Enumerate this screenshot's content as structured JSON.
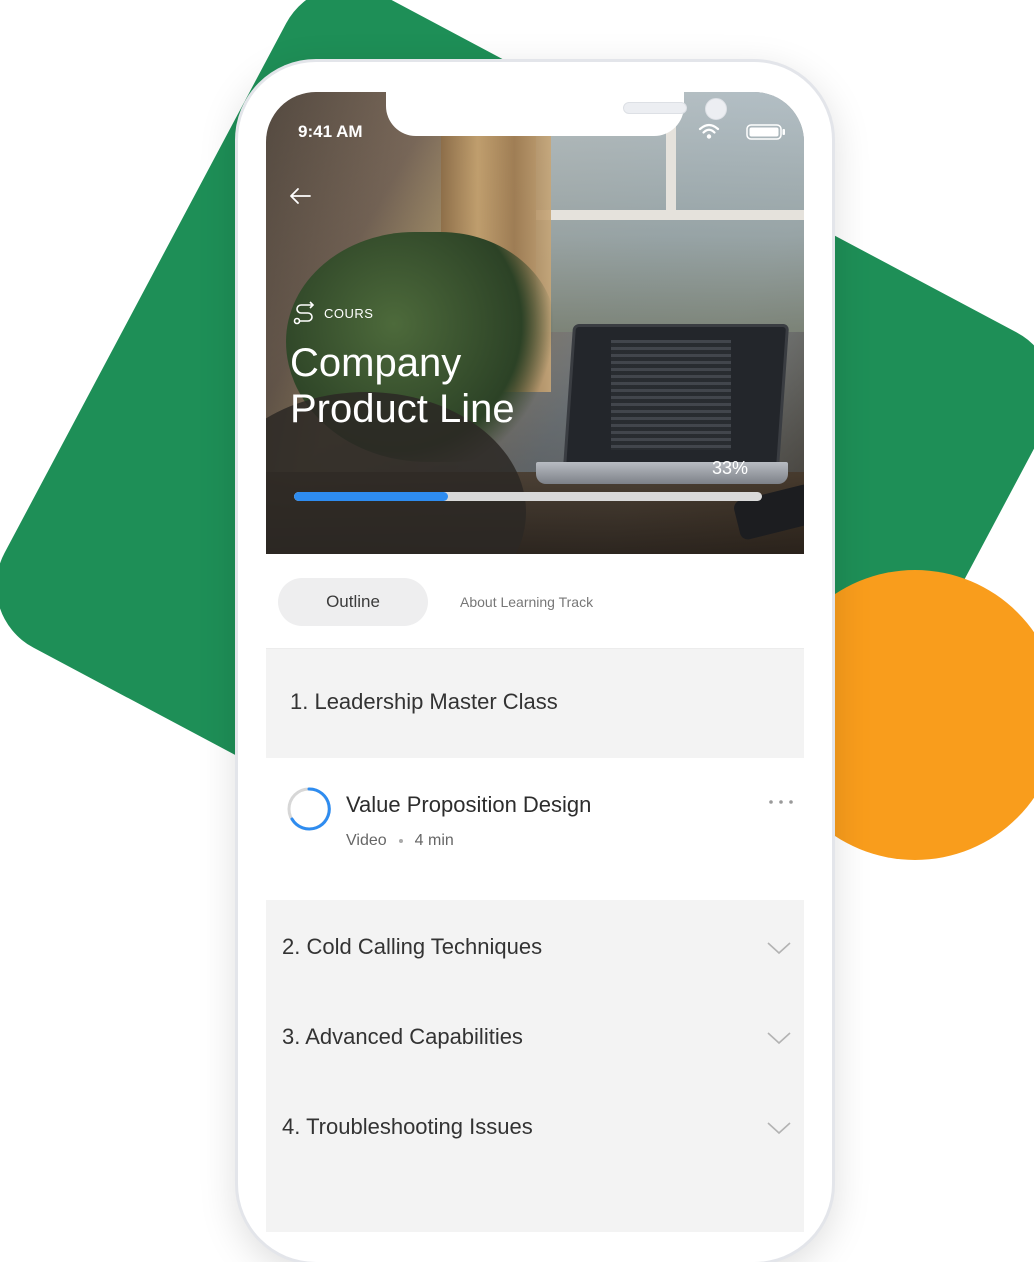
{
  "status": {
    "time": "9:41 AM"
  },
  "course": {
    "type_label": "COURS",
    "title": "Company Product Line",
    "progress_label": "33%",
    "progress_value": 0.33
  },
  "tabs": [
    {
      "label": "Outline",
      "active": true
    },
    {
      "label": "About Learning Track",
      "active": false
    }
  ],
  "sections": [
    {
      "label": "1. Leadership Master Class",
      "expanded": true,
      "lessons": [
        {
          "title": "Value Proposition Design",
          "kind": "Video",
          "duration": "4 min"
        }
      ]
    },
    {
      "label": "2. Cold Calling Techniques",
      "expanded": false
    },
    {
      "label": "3. Advanced Capabilities",
      "expanded": false
    },
    {
      "label": "4. Troubleshooting Issues",
      "expanded": false
    }
  ],
  "colors": {
    "background_green": "#1e8f57",
    "background_orange": "#f99d1c",
    "progress_blue": "#2e8cf0"
  },
  "icons": [
    "back-arrow-icon",
    "route-icon",
    "wifi-icon",
    "battery-icon",
    "progress-ring-icon",
    "more-icon",
    "chevron-down-icon"
  ]
}
